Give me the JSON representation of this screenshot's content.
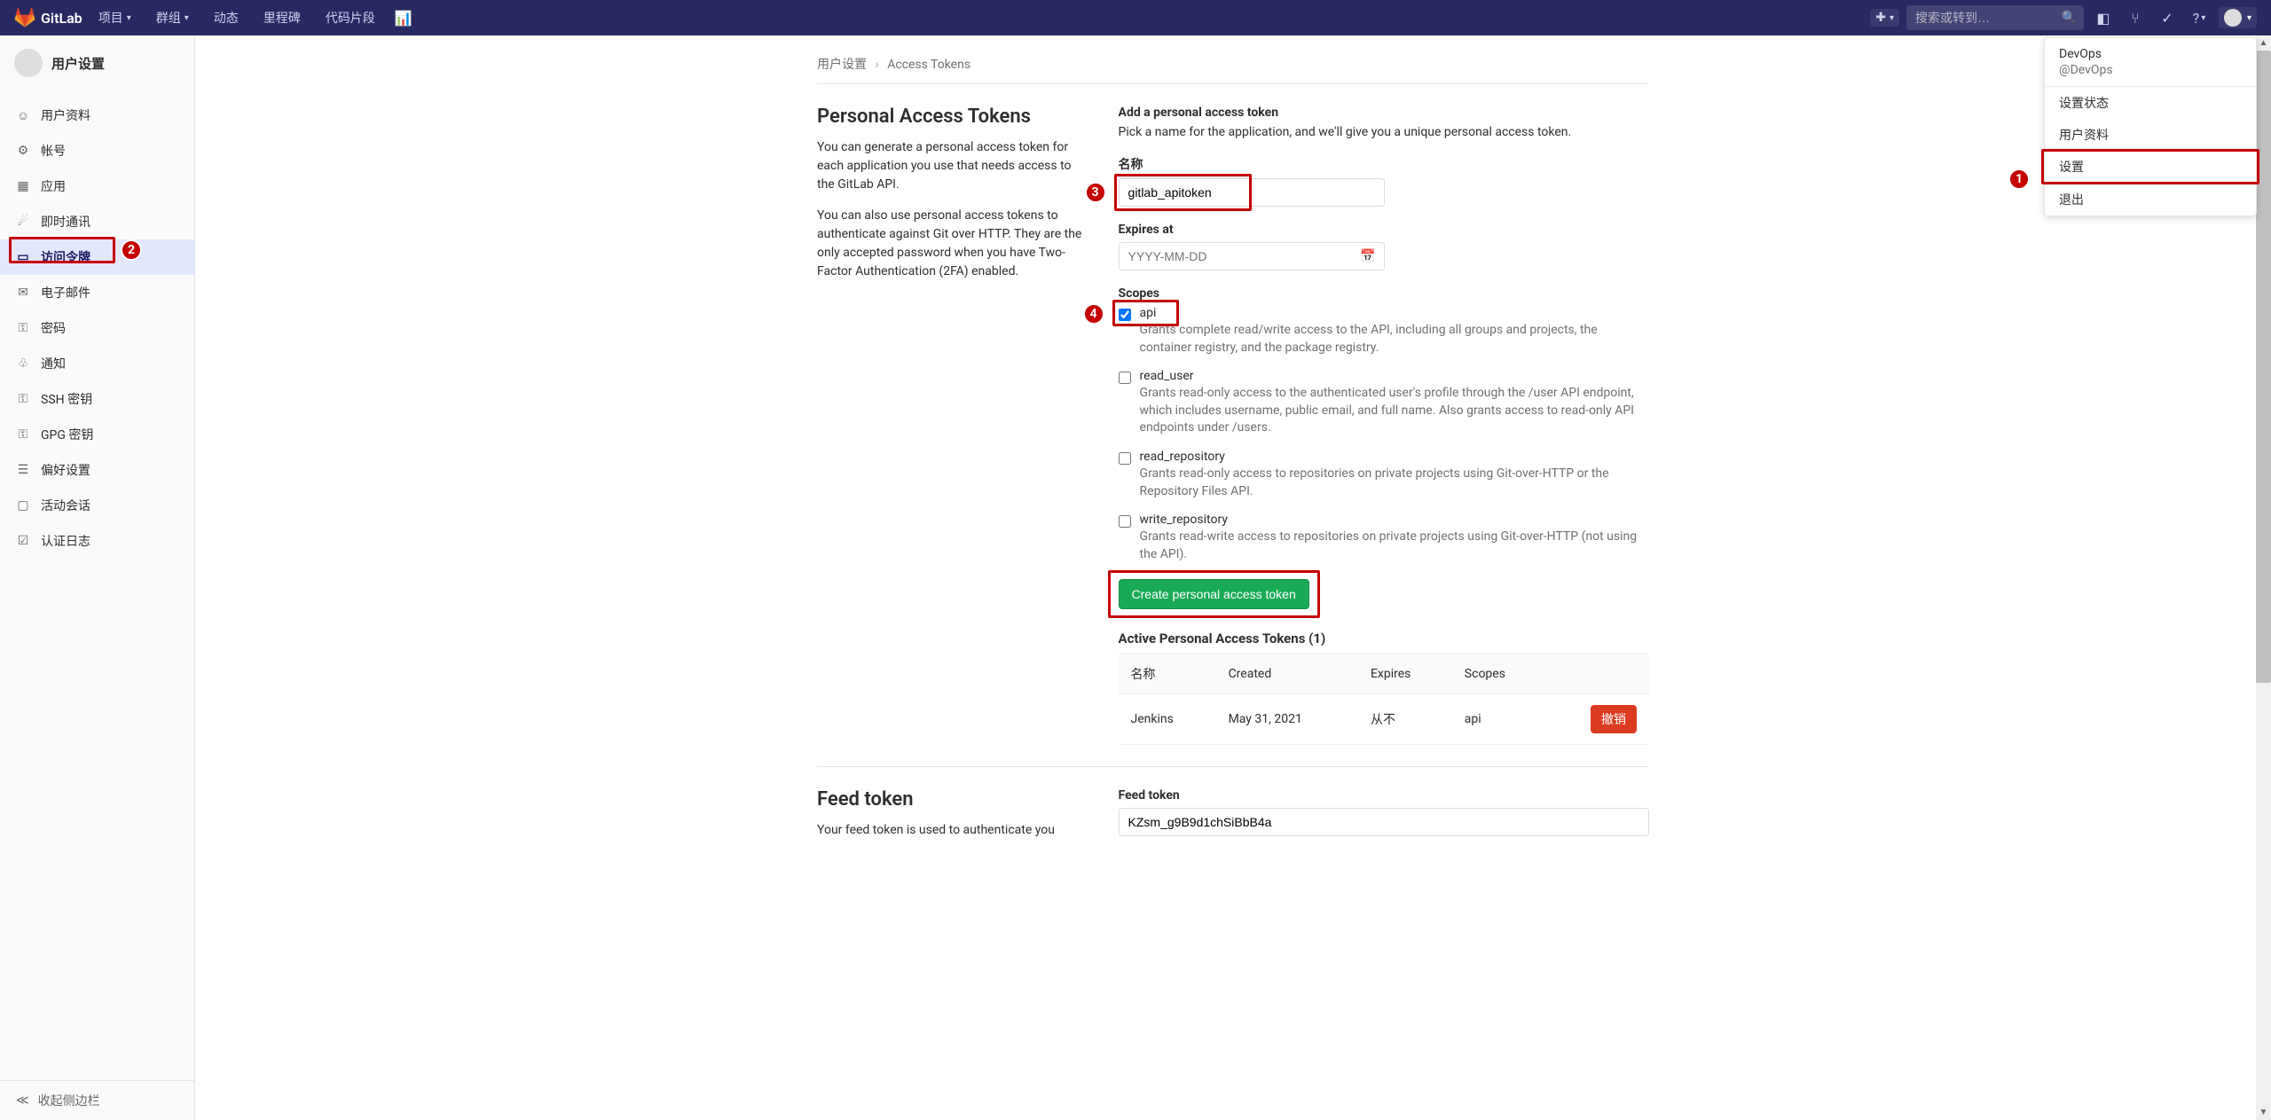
{
  "navbar": {
    "brand": "GitLab",
    "items": [
      {
        "label": "项目",
        "dropdown": true
      },
      {
        "label": "群组",
        "dropdown": true
      },
      {
        "label": "动态",
        "dropdown": false
      },
      {
        "label": "里程碑",
        "dropdown": false
      },
      {
        "label": "代码片段",
        "dropdown": false
      }
    ],
    "search_placeholder": "搜索或转到…"
  },
  "sidebar": {
    "title": "用户设置",
    "items": [
      {
        "icon": "👤",
        "label": "用户资料"
      },
      {
        "icon": "⚙",
        "label": "帐号"
      },
      {
        "icon": "▦",
        "label": "应用"
      },
      {
        "icon": "💬",
        "label": "即时通讯"
      },
      {
        "icon": "🔑",
        "label": "访问令牌",
        "active": true
      },
      {
        "icon": "✉",
        "label": "电子邮件"
      },
      {
        "icon": "🔒",
        "label": "密码"
      },
      {
        "icon": "🔔",
        "label": "通知"
      },
      {
        "icon": "🔑",
        "label": "SSH 密钥"
      },
      {
        "icon": "🔑",
        "label": "GPG 密钥"
      },
      {
        "icon": "☰",
        "label": "偏好设置"
      },
      {
        "icon": "🖥",
        "label": "活动会话"
      },
      {
        "icon": "☑",
        "label": "认证日志"
      }
    ],
    "collapse": "收起侧边栏"
  },
  "breadcrumb": {
    "root": "用户设置",
    "current": "Access Tokens"
  },
  "pat": {
    "heading": "Personal Access Tokens",
    "desc1": "You can generate a personal access token for each application you use that needs access to the GitLab API.",
    "desc2": "You can also use personal access tokens to authenticate against Git over HTTP. They are the only accepted password when you have Two-Factor Authentication (2FA) enabled.",
    "add_heading": "Add a personal access token",
    "add_desc": "Pick a name for the application, and we'll give you a unique personal access token.",
    "name_label": "名称",
    "name_value": "gitlab_apitoken",
    "expires_label": "Expires at",
    "expires_placeholder": "YYYY-MM-DD",
    "scopes_label": "Scopes",
    "scopes": [
      {
        "name": "api",
        "checked": true,
        "desc": "Grants complete read/write access to the API, including all groups and projects, the container registry, and the package registry."
      },
      {
        "name": "read_user",
        "checked": false,
        "desc": "Grants read-only access to the authenticated user's profile through the /user API endpoint, which includes username, public email, and full name. Also grants access to read-only API endpoints under /users."
      },
      {
        "name": "read_repository",
        "checked": false,
        "desc": "Grants read-only access to repositories on private projects using Git-over-HTTP or the Repository Files API."
      },
      {
        "name": "write_repository",
        "checked": false,
        "desc": "Grants read-write access to repositories on private projects using Git-over-HTTP (not using the API)."
      }
    ],
    "create_btn": "Create personal access token"
  },
  "active": {
    "heading": "Active Personal Access Tokens (1)",
    "cols": {
      "name": "名称",
      "created": "Created",
      "expires": "Expires",
      "scopes": "Scopes"
    },
    "rows": [
      {
        "name": "Jenkins",
        "created": "May 31, 2021",
        "expires": "从不",
        "scopes": "api",
        "revoke": "撤销"
      }
    ]
  },
  "feed": {
    "heading": "Feed token",
    "desc": "Your feed token is used to authenticate you",
    "label": "Feed token",
    "value": "KZsm_g9B9d1chSiBbB4a"
  },
  "user_menu": {
    "name": "DevOps",
    "handle": "@DevOps",
    "items": [
      {
        "label": "设置状态"
      },
      {
        "label": "用户资料"
      },
      {
        "label": "设置",
        "highlight": true
      },
      {
        "label": "退出"
      }
    ]
  }
}
